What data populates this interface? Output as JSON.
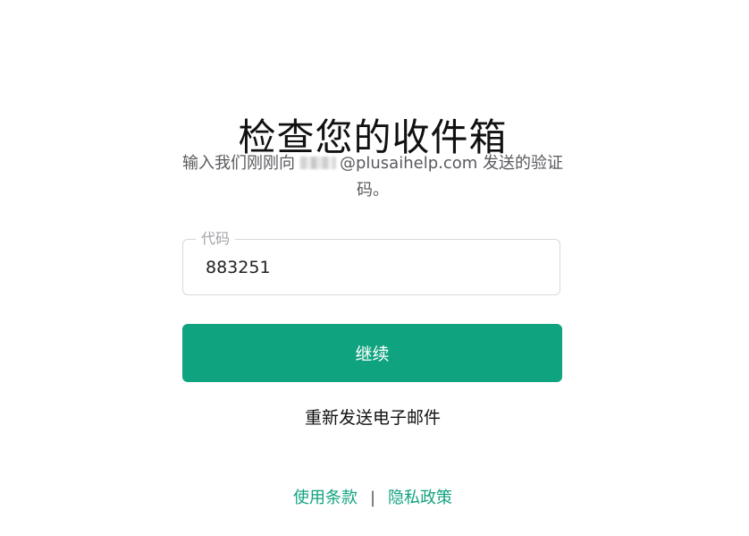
{
  "header": {
    "title": "检查您的收件箱"
  },
  "subtitle": {
    "prefix": "输入我们刚刚向",
    "email_domain": "@plusaihelp.com",
    "suffix": "发送的验证码。"
  },
  "code_field": {
    "label": "代码",
    "value": "883251"
  },
  "actions": {
    "continue_label": "继续",
    "resend_label": "重新发送电子邮件"
  },
  "footer": {
    "terms_label": "使用条款",
    "divider": "|",
    "privacy_label": "隐私政策"
  },
  "colors": {
    "accent": "#10a37f",
    "border": "#d7d8dd",
    "muted_text": "#5a5a5f"
  }
}
